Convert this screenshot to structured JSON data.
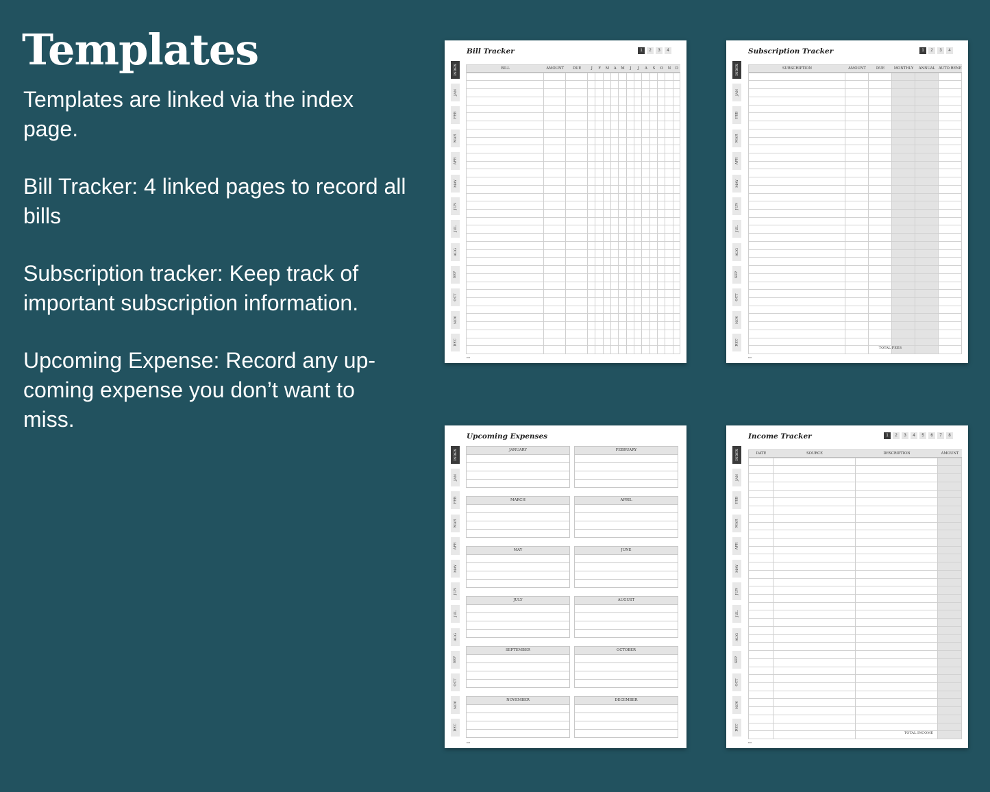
{
  "heading": "Templates",
  "paragraphs": [
    "Templates are linked via the index page.",
    "Bill Tracker: 4 linked pages to record all bills",
    "Subscription tracker: Keep track of important subscription information.",
    "Upcoming Expense: Record any up-coming  expense you don’t want to miss."
  ],
  "tabs": [
    "INDEX",
    "JAN",
    "FEB",
    "MAR",
    "APR",
    "MAY",
    "JUN",
    "JUL",
    "AUG",
    "SEP",
    "OCT",
    "NOV",
    "DEC"
  ],
  "bill_tracker": {
    "title": "Bill Tracker",
    "page_numbers": [
      "1",
      "2",
      "3",
      "4"
    ],
    "active_page": 0,
    "columns": [
      "BILL",
      "AMOUNT",
      "DUE",
      "J",
      "F",
      "M",
      "A",
      "M",
      "J",
      "J",
      "A",
      "S",
      "O",
      "N",
      "D"
    ]
  },
  "subscription_tracker": {
    "title": "Subscription Tracker",
    "page_numbers": [
      "1",
      "2",
      "3",
      "4"
    ],
    "active_page": 0,
    "columns": [
      "SUBSCRIPTION",
      "AMOUNT",
      "DUE",
      "MONTHLY",
      "ANNUAL",
      "AUTO RENEW?"
    ],
    "total_label": "TOTAL FEES"
  },
  "upcoming_expenses": {
    "title": "Upcoming Expenses",
    "months": [
      "JANUARY",
      "FEBRUARY",
      "MARCH",
      "APRIL",
      "MAY",
      "JUNE",
      "JULY",
      "AUGUST",
      "SEPTEMBER",
      "OCTOBER",
      "NOVEMBER",
      "DECEMBER"
    ]
  },
  "income_tracker": {
    "title": "Income Tracker",
    "page_numbers": [
      "1",
      "2",
      "3",
      "4",
      "5",
      "6",
      "7",
      "8"
    ],
    "active_page": 0,
    "columns": [
      "DATE",
      "SOURCE",
      "DESCRIPTION",
      "AMOUNT"
    ],
    "total_label": "TOTAL INCOME"
  },
  "colors": {
    "background": "#22525f",
    "page": "#ffffff",
    "active_tab": "#3a3a3a",
    "shade": "#e3e3e3"
  }
}
